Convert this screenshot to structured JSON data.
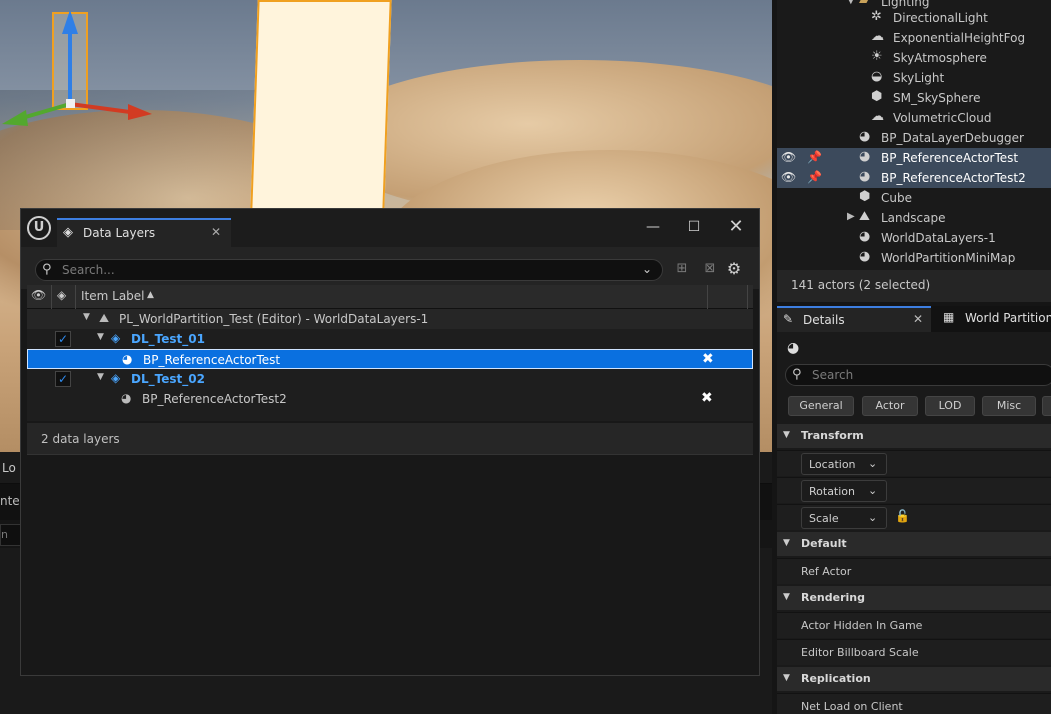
{
  "dialog": {
    "tab_label": "Data Layers",
    "logo_glyph": "U",
    "search_placeholder": "Search...",
    "column_item_label": "Item Label",
    "tree": {
      "world": "PL_WorldPartition_Test (Editor) - WorldDataLayers-1",
      "layer1": "DL_Test_01",
      "actor1": "BP_ReferenceActorTest",
      "layer2": "DL_Test_02",
      "actor2": "BP_ReferenceActorTest2"
    },
    "status": "2 data layers"
  },
  "console": {
    "tab_fragment": "Lo",
    "row_fragment": "nter",
    "input_fragment": "n"
  },
  "outliner": {
    "items": [
      {
        "label": "Lighting"
      },
      {
        "label": "DirectionalLight"
      },
      {
        "label": "ExponentialHeightFog"
      },
      {
        "label": "SkyAtmosphere"
      },
      {
        "label": "SkyLight"
      },
      {
        "label": "SM_SkySphere"
      },
      {
        "label": "VolumetricCloud"
      },
      {
        "label": "BP_DataLayerDebugger"
      },
      {
        "label": "BP_ReferenceActorTest"
      },
      {
        "label": "BP_ReferenceActorTest2"
      },
      {
        "label": "Cube"
      },
      {
        "label": "Landscape"
      },
      {
        "label": "WorldDataLayers-1"
      },
      {
        "label": "WorldPartitionMiniMap"
      }
    ],
    "status": "141 actors (2 selected)"
  },
  "details": {
    "tab_label": "Details",
    "tab2_label": "World Partition",
    "search_placeholder": "Search",
    "filters": [
      "General",
      "Actor",
      "LOD",
      "Misc"
    ],
    "categories": {
      "transform": "Transform",
      "default": "Default",
      "rendering": "Rendering",
      "replication": "Replication"
    },
    "transform_props": {
      "location": "Location",
      "rotation": "Rotation",
      "scale": "Scale"
    },
    "props": {
      "ref_actor": "Ref Actor",
      "actor_hidden": "Actor Hidden In Game",
      "billboard_scale": "Editor Billboard Scale",
      "net_load": "Net Load on Client"
    }
  },
  "colors": {
    "accent_blue": "#0a70e0",
    "data_layer_text": "#4aa6ff",
    "outliner_selection": "#3c4a5c",
    "selection_outline": "#f0a020"
  }
}
